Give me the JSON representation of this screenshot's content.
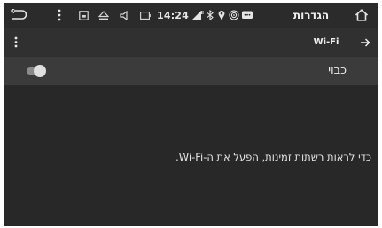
{
  "status_bar": {
    "time": "14:24",
    "title": "הגדרות",
    "icons": [
      "back-arrow-icon",
      "overflow-menu-icon",
      "screenshot-icon",
      "eject-icon",
      "volume-mute-icon",
      "battery-icon",
      "signal-icon",
      "bluetooth-icon",
      "location-icon",
      "wifi-hotspot-icon",
      "message-icon",
      "home-icon"
    ]
  },
  "toolbar": {
    "title": "Wi-Fi",
    "icons": [
      "overflow-menu-icon",
      "forward-arrow-icon"
    ]
  },
  "master_switch": {
    "label": "כבוי",
    "state": "off"
  },
  "empty_message": "כדי לראות רשתות זמינות, הפעל את ה-Wi-Fi.",
  "colors": {
    "background": "#282828",
    "statusbar": "#2b2b2b",
    "toolbar": "#303030",
    "switch_row": "#3b3b3b",
    "text": "#e6e6e6"
  }
}
